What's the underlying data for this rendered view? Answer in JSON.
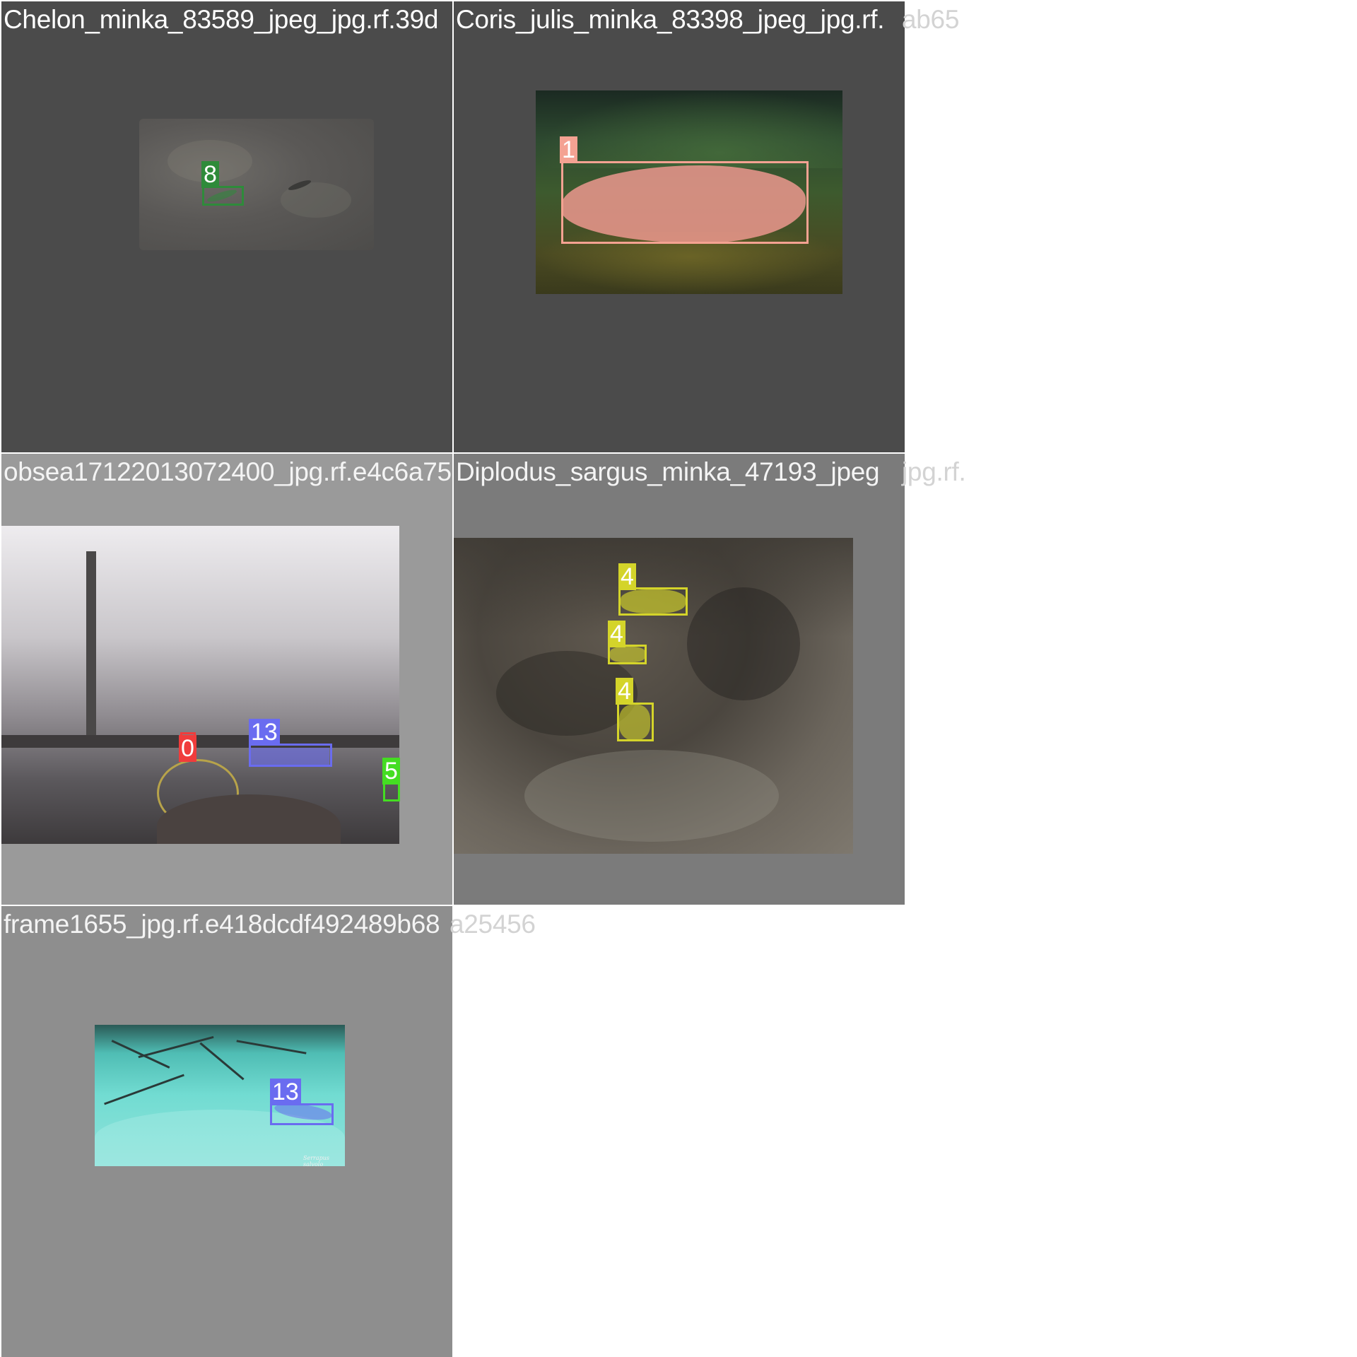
{
  "tiles": [
    {
      "title": "Chelon_minka_83589_jpeg_jpg.rf.39d",
      "overflow_title": "",
      "background": "#4b4b4b",
      "detections": [
        {
          "class_id": "8",
          "color": "#2e8b3a"
        }
      ]
    },
    {
      "title": "Coris_julis_minka_83398_jpeg_jpg.rf.",
      "overflow_title": "ab65",
      "background": "#4b4b4b",
      "detections": [
        {
          "class_id": "1",
          "color": "#f4a292"
        }
      ]
    },
    {
      "title": "obsea17122013072400_jpg.rf.e4c6a75",
      "overflow_title": "",
      "background": "#9a9a9a",
      "detections": [
        {
          "class_id": "0",
          "color": "#f03c3c"
        },
        {
          "class_id": "13",
          "color": "#6a6cf0"
        },
        {
          "class_id": "5",
          "color": "#44dd22"
        }
      ]
    },
    {
      "title": "Diplodus_sargus_minka_47193_jpeg",
      "overflow_title": "jpg.rf.",
      "background": "#7b7b7b",
      "detections": [
        {
          "class_id": "4",
          "color": "#d4d42a"
        },
        {
          "class_id": "4",
          "color": "#d4d42a"
        },
        {
          "class_id": "4",
          "color": "#d4d42a"
        }
      ]
    },
    {
      "title": "frame1655_jpg.rf.e418dcdf492489b68",
      "overflow_title": "a25456",
      "background": "#8e8e8e",
      "detections": [
        {
          "class_id": "13",
          "color": "#6a6cf0"
        }
      ],
      "photo_caption": "Serrapus salvolo"
    }
  ]
}
